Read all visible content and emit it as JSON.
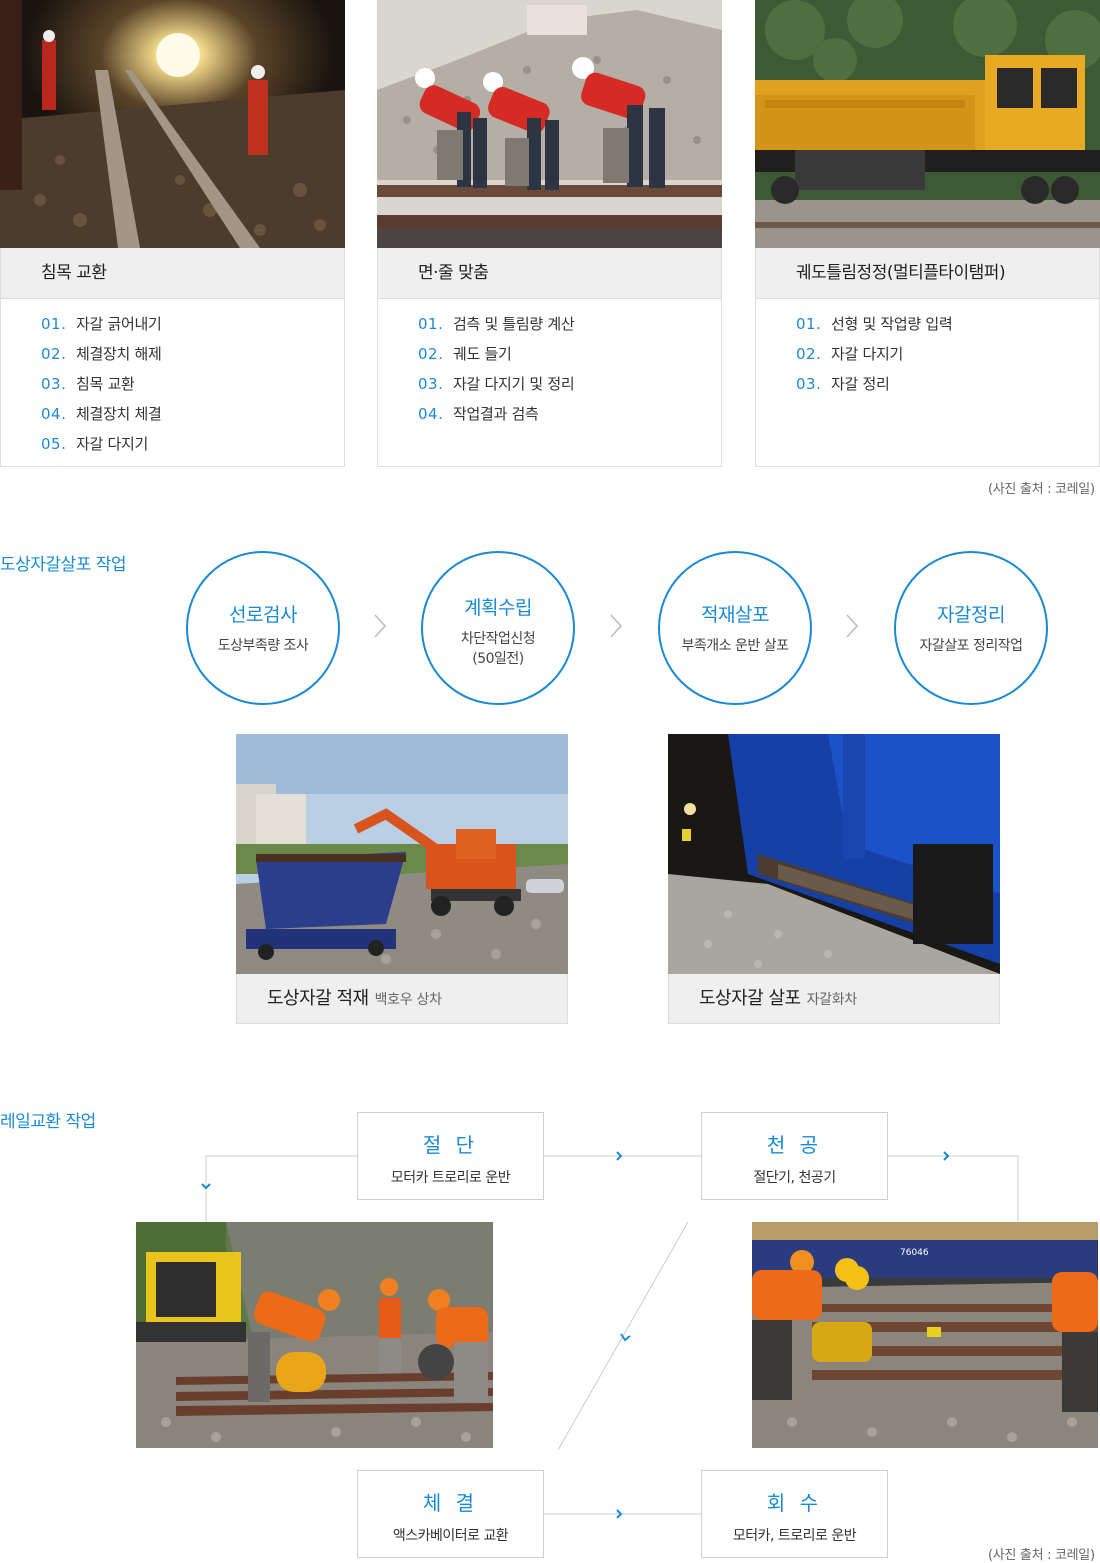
{
  "cards": [
    {
      "title": "침목 교환",
      "steps": [
        {
          "num": "01.",
          "label": "자갈 긁어내기"
        },
        {
          "num": "02.",
          "label": "체결장치 해제"
        },
        {
          "num": "03.",
          "label": "침목 교환"
        },
        {
          "num": "04.",
          "label": "체결장치 체결"
        },
        {
          "num": "05.",
          "label": "자갈 다지기"
        }
      ]
    },
    {
      "title": "면·줄 맞춤",
      "steps": [
        {
          "num": "01.",
          "label": "검측 및 틀림량 계산"
        },
        {
          "num": "02.",
          "label": "궤도 들기"
        },
        {
          "num": "03.",
          "label": "자갈 다지기 및 정리"
        },
        {
          "num": "04.",
          "label": "작업결과 검측"
        }
      ]
    },
    {
      "title": "궤도틀림정정(멀티플타이탬퍼)",
      "steps": [
        {
          "num": "01.",
          "label": "선형 및 작업량 입력"
        },
        {
          "num": "02.",
          "label": "자갈 다지기"
        },
        {
          "num": "03.",
          "label": "자갈 정리"
        }
      ]
    }
  ],
  "credit_top": "(사진 출처 : 코레일)",
  "ballast": {
    "title": "도상자갈살포 작업",
    "steps": [
      {
        "title": "선로검사",
        "sub": "도상부족량 조사"
      },
      {
        "title": "계획수립",
        "sub": "차단작업신청\n(50일전)"
      },
      {
        "title": "적재살포",
        "sub": "부족개소 운반 살포"
      },
      {
        "title": "자갈정리",
        "sub": "자갈살포 정리작업"
      }
    ],
    "photos": [
      {
        "caption": "도상자갈 적재",
        "sub": "백호우 상차"
      },
      {
        "caption": "도상자갈 살포",
        "sub": "자갈화차"
      }
    ]
  },
  "rail": {
    "title": "레일교환 작업",
    "boxes": {
      "cut": {
        "title": "절 단",
        "sub": "모터카 트로리로 운반"
      },
      "drill": {
        "title": "천 공",
        "sub": "절단기, 천공기"
      },
      "fasten": {
        "title": "체 결",
        "sub": "액스카베이터로 교환"
      },
      "collect": {
        "title": "회 수",
        "sub": "모터카, 트로리로 운반"
      }
    },
    "wagon_number": "76046"
  },
  "credit_bottom": "(사진 출처 : 코레일)",
  "colors": {
    "accent": "#1a8ad4",
    "card_title_bg": "#efefef",
    "border": "#dddddd"
  }
}
